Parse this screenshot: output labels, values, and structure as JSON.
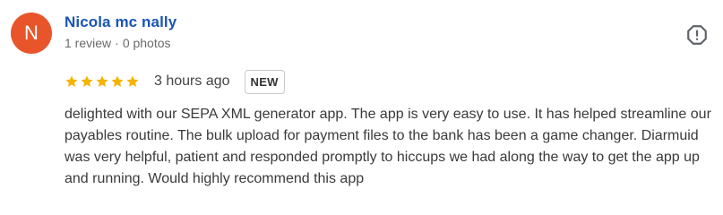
{
  "reviewer": {
    "avatar_initial": "N",
    "avatar_color": "#e8552b",
    "name": "Nicola mc nally",
    "review_count": "1 review",
    "separator": "·",
    "photo_count": "0 photos"
  },
  "actions": {
    "report_icon": "report-octagon-icon"
  },
  "rating": {
    "stars": 5,
    "max_stars": 5,
    "star_color": "#f4b400",
    "star_icon": "star-icon",
    "time_ago": "3 hours ago",
    "badge": "NEW"
  },
  "review": {
    "text": "delighted with our SEPA XML generator app. The app is very easy to use. It has helped streamline our payables routine. The bulk upload for payment files to the bank has been a game changer. Diarmuid was very helpful, patient and responded promptly to hiccups we had along the way to get the app up and running. Would highly recommend this app"
  },
  "colors": {
    "name_link": "#1a55b4",
    "meta_text": "#6b6b6b",
    "body_text": "#3a3a3a"
  }
}
